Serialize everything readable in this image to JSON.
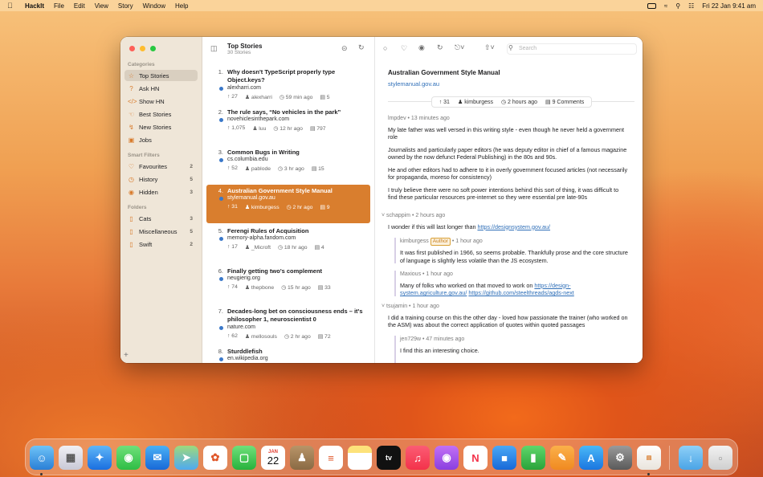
{
  "menubar": {
    "app": "HackIt",
    "items": [
      "File",
      "Edit",
      "View",
      "Story",
      "Window",
      "Help"
    ],
    "datetime": "Fri 22 Jan  9:41 am"
  },
  "sidebar": {
    "sections": {
      "categories": "Categories",
      "smart": "Smart Filters",
      "folders": "Folders"
    },
    "categories": [
      {
        "label": "Top Stories",
        "icon": "star-icon"
      },
      {
        "label": "Ask HN",
        "icon": "question-icon"
      },
      {
        "label": "Show HN",
        "icon": "code-icon"
      },
      {
        "label": "Best Stories",
        "icon": "thumb-icon"
      },
      {
        "label": "New Stories",
        "icon": "bolt-icon"
      },
      {
        "label": "Jobs",
        "icon": "briefcase-icon"
      }
    ],
    "smart": [
      {
        "label": "Favourites",
        "count": "2",
        "icon": "heart-icon"
      },
      {
        "label": "History",
        "count": "5",
        "icon": "clock-icon"
      },
      {
        "label": "Hidden",
        "count": "3",
        "icon": "eye-icon"
      }
    ],
    "folders": [
      {
        "label": "Cats",
        "count": "3"
      },
      {
        "label": "Miscellaneous",
        "count": "5"
      },
      {
        "label": "Swift",
        "count": "2"
      }
    ]
  },
  "list": {
    "title": "Top Stories",
    "subtitle": "30 Stories",
    "stories": [
      {
        "num": "1.",
        "title": "Why doesn't TypeScript properly type Object.keys?",
        "domain": "alexharri.com",
        "points": "27",
        "user": "alexharri",
        "time": "59 min ago",
        "comments": "5"
      },
      {
        "num": "2.",
        "title": "The rule says, “No vehicles in the park”",
        "domain": "novehiclesinthepark.com",
        "points": "1,075",
        "user": "luu",
        "time": "12 hr ago",
        "comments": "797"
      },
      {
        "num": "3.",
        "title": "Common Bugs in Writing",
        "domain": "cs.columbia.edu",
        "points": "52",
        "user": "pablode",
        "time": "3 hr ago",
        "comments": "15"
      },
      {
        "num": "4.",
        "title": "Australian Government Style Manual",
        "domain": "stylemanual.gov.au",
        "points": "31",
        "user": "kimburgess",
        "time": "2 hr ago",
        "comments": "9"
      },
      {
        "num": "5.",
        "title": "Ferengi Rules of Acquisition",
        "domain": "memory-alpha.fandom.com",
        "points": "17",
        "user": "_Microft",
        "time": "18 hr ago",
        "comments": "4"
      },
      {
        "num": "6.",
        "title": "Finally getting two's complement",
        "domain": "neugierig.org",
        "points": "74",
        "user": "thepbone",
        "time": "15 hr ago",
        "comments": "33"
      },
      {
        "num": "7.",
        "title": "Decades-long bet on consciousness ends – it's philosopher 1, neuroscientist 0",
        "domain": "nature.com",
        "points": "62",
        "user": "mellosouls",
        "time": "2 hr ago",
        "comments": "72"
      },
      {
        "num": "8.",
        "title": "Sturddlefish",
        "domain": "en.wikipedia.org",
        "points": "",
        "user": "",
        "time": "",
        "comments": ""
      }
    ]
  },
  "detail": {
    "search_placeholder": "Search",
    "title": "Australian Government Style Manual",
    "link": "stylemanual.gov.au",
    "stats": {
      "points": "31",
      "user": "kimburgess",
      "time": "2 hours ago",
      "comments": "9 Comments"
    },
    "comments": {
      "c1": {
        "header": "lmpdev • 13 minutes ago",
        "p1": "My late father was well versed in this writing style - even though he never held a government role",
        "p2": "Journalists and particularly paper editors (he was deputy editor in chief of a famous magazine owned by the now defunct Federal Publishing) in the 80s and 90s.",
        "p3": "He and other editors had to adhere to it in overly government focused articles (not necessarily for propaganda, moreso for consistency)",
        "p4": "I truly believe there were no soft power intentions behind this sort of thing, it was difficult to find these particular resources pre-internet so they were essential pre late-90s"
      },
      "c2": {
        "header": "schappim • 2 hours ago",
        "text": "I wonder if this will last longer than ",
        "link": "https://designsystem.gov.au/"
      },
      "c3": {
        "user": "kimburgess",
        "badge": "Author",
        "time": "• 1 hour ago",
        "text": "It was first published in 1966, so seems probable. Thankfully prose and the core structure of language is slightly less volatile than the JS ecosystem."
      },
      "c4": {
        "header": "Maxious • 1 hour ago",
        "text": "Many of folks who worked on that moved to work on ",
        "link1": "https://design-system.agriculture.gov.au/",
        "link2": "https://github.com/steelthreads/agds-next"
      },
      "c5": {
        "header": "tsujamin • 1 hour ago",
        "text": "I did a training course on this the other day - loved how passionate the trainer (who worked on the ASM) was about the correct application of quotes within quoted passages"
      },
      "c6": {
        "header": "jen729w • 47 minutes ago",
        "text": "I find this an interesting choice."
      }
    }
  },
  "dock": {
    "calendar_month": "JAN",
    "calendar_day": "22",
    "tv_label": "tv"
  }
}
